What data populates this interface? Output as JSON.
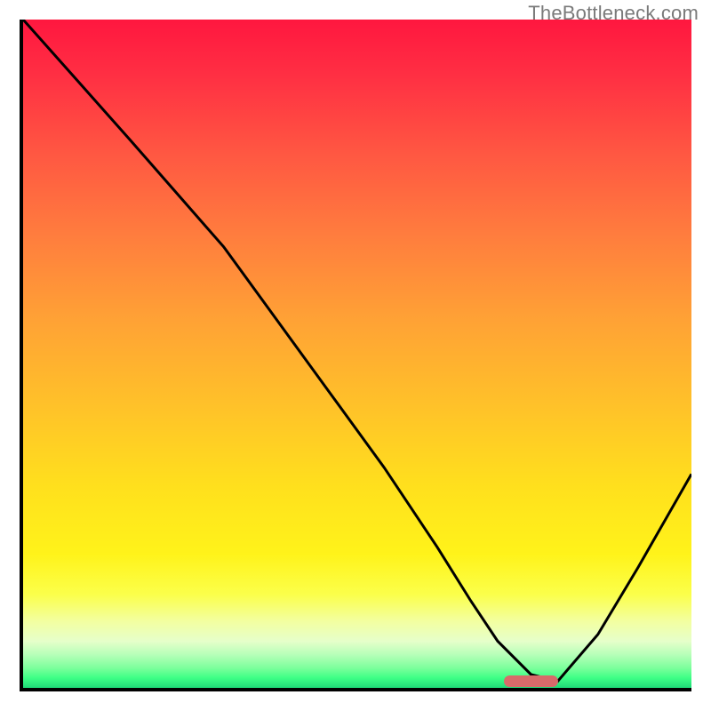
{
  "watermark": {
    "text": "TheBottleneck.com"
  },
  "chart_data": {
    "type": "line",
    "title": "",
    "xlabel": "",
    "ylabel": "",
    "xlim": [
      0,
      100
    ],
    "ylim": [
      0,
      100
    ],
    "series": [
      {
        "name": "bottleneck-curve",
        "x": [
          0,
          8,
          16,
          23,
          30,
          38,
          46,
          54,
          62,
          67,
          71,
          76,
          80,
          86,
          92,
          100
        ],
        "y": [
          100,
          91,
          82,
          74,
          66,
          55,
          44,
          33,
          21,
          13,
          7,
          2,
          1,
          8,
          18,
          32
        ]
      }
    ],
    "marker": {
      "name": "optimal-zone",
      "x_start": 72,
      "x_end": 80,
      "y": 1,
      "color": "#d86a6a"
    },
    "background": {
      "style": "vertical-gradient",
      "top_color": "#ff173f",
      "bottom_color": "#1fd877"
    }
  }
}
